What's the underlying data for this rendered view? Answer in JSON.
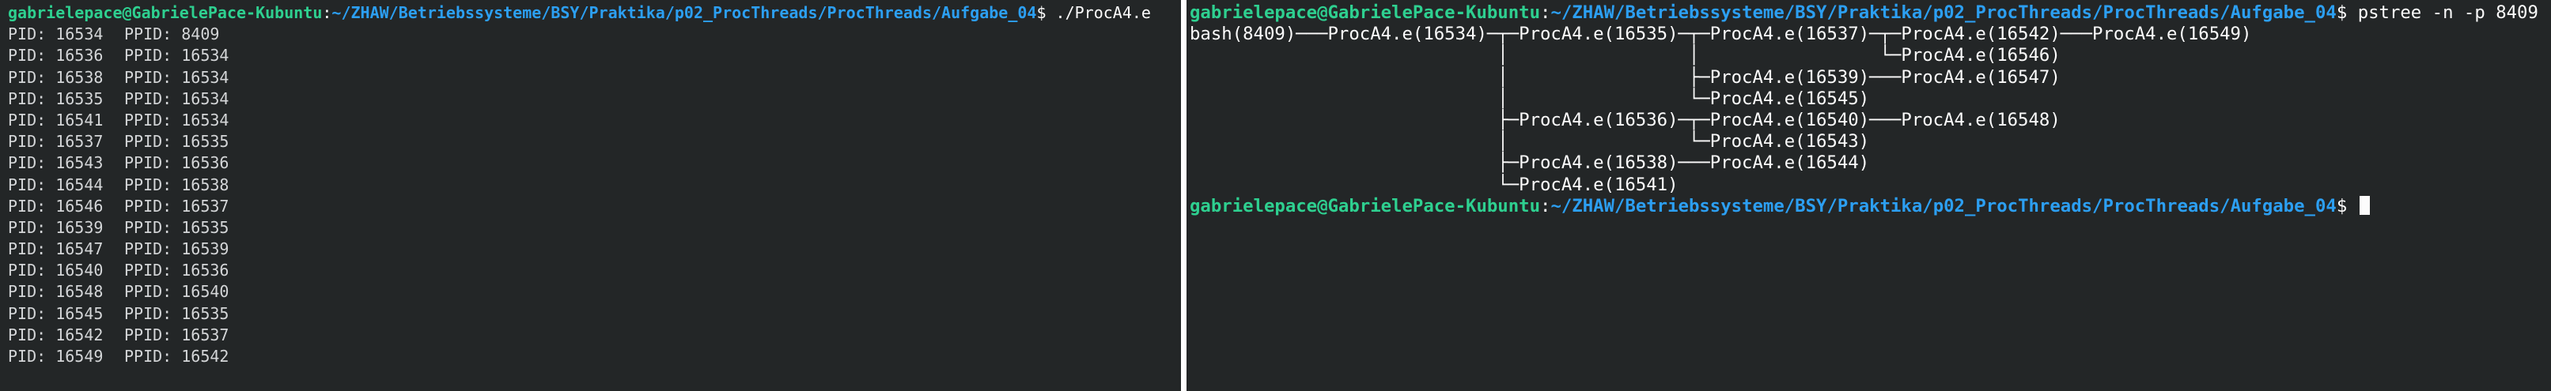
{
  "prompt": {
    "user_host": "gabrielepace@GabrielePace-Kubuntu",
    "separator": ":",
    "path": "~/ZHAW/Betriebssysteme/BSY/Praktika/p02_ProcThreads/ProcThreads/Aufgabe_04",
    "symbol": "$"
  },
  "left_terminal": {
    "command": "./ProcA4.e",
    "rows": [
      {
        "pid": "PID: 16534",
        "ppid": "PPID: 8409"
      },
      {
        "pid": "PID: 16536",
        "ppid": "PPID: 16534"
      },
      {
        "pid": "PID: 16538",
        "ppid": "PPID: 16534"
      },
      {
        "pid": "PID: 16535",
        "ppid": "PPID: 16534"
      },
      {
        "pid": "PID: 16541",
        "ppid": "PPID: 16534"
      },
      {
        "pid": "PID: 16537",
        "ppid": "PPID: 16535"
      },
      {
        "pid": "PID: 16543",
        "ppid": "PPID: 16536"
      },
      {
        "pid": "PID: 16544",
        "ppid": "PPID: 16538"
      },
      {
        "pid": "PID: 16546",
        "ppid": "PPID: 16537"
      },
      {
        "pid": "PID: 16539",
        "ppid": "PPID: 16535"
      },
      {
        "pid": "PID: 16547",
        "ppid": "PPID: 16539"
      },
      {
        "pid": "PID: 16540",
        "ppid": "PPID: 16536"
      },
      {
        "pid": "PID: 16548",
        "ppid": "PPID: 16540"
      },
      {
        "pid": "PID: 16545",
        "ppid": "PPID: 16535"
      },
      {
        "pid": "PID: 16542",
        "ppid": "PPID: 16537"
      },
      {
        "pid": "PID: 16549",
        "ppid": "PPID: 16542"
      }
    ]
  },
  "right_terminal": {
    "command": "pstree -n -p 8409",
    "tree_lines": [
      "bash(8409)───ProcA4.e(16534)─┬─ProcA4.e(16535)─┬─ProcA4.e(16537)─┬─ProcA4.e(16542)───ProcA4.e(16549)",
      "                             │                 │                 └─ProcA4.e(16546)",
      "                             │                 ├─ProcA4.e(16539)───ProcA4.e(16547)",
      "                             │                 └─ProcA4.e(16545)",
      "                             ├─ProcA4.e(16536)─┬─ProcA4.e(16540)───ProcA4.e(16548)",
      "                             │                 └─ProcA4.e(16543)",
      "                             ├─ProcA4.e(16538)───ProcA4.e(16544)",
      "                             └─ProcA4.e(16541)"
    ]
  },
  "colors": {
    "terminal_background": "#232627",
    "prompt_user": "#2ed090",
    "prompt_path": "#2c9ff2",
    "text": "#fcfcfc"
  }
}
